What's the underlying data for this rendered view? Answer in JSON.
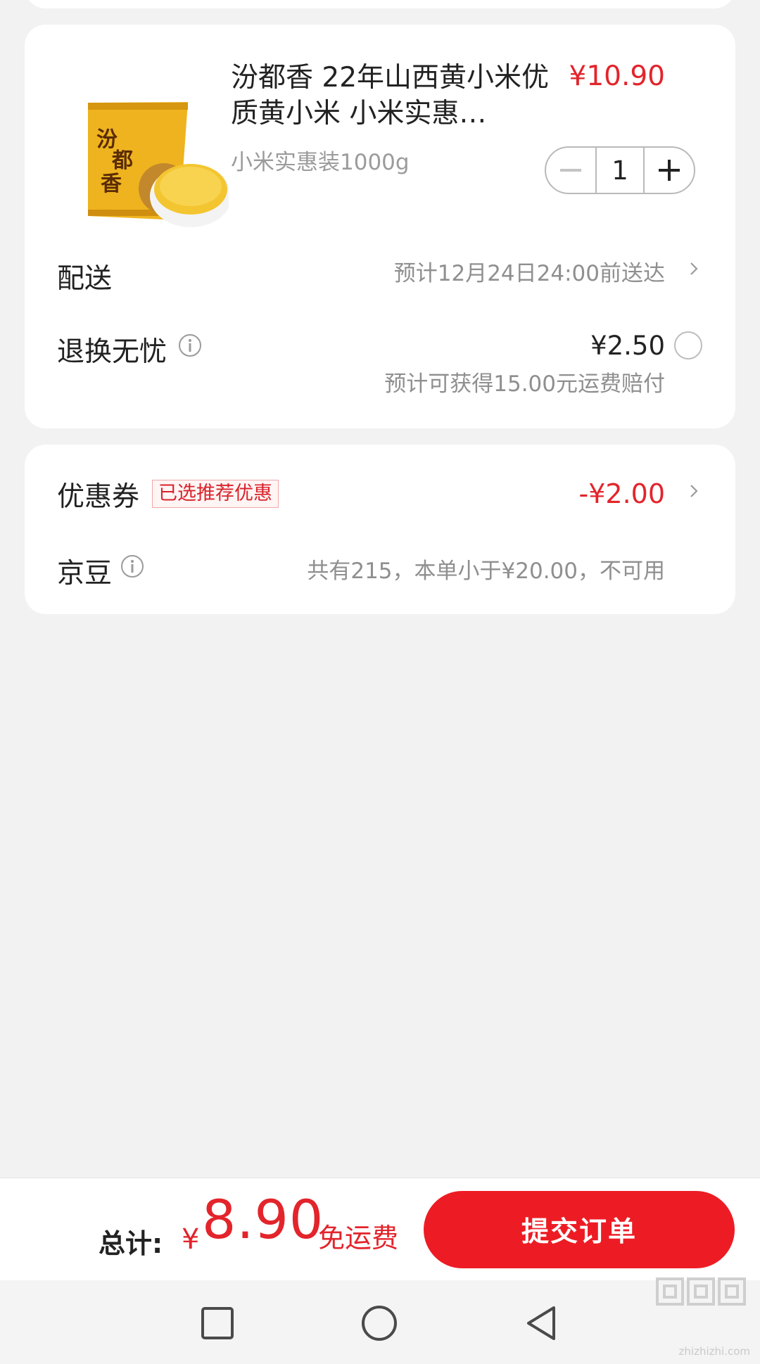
{
  "product": {
    "title": "汾都香 22年山西黄小米优质黄小米 小米实惠…",
    "price": "¥10.90",
    "spec": "小米实惠装1000g",
    "quantity": "1",
    "image_text": "汾都香"
  },
  "delivery": {
    "label": "配送",
    "value": "预计12月24日24:00前送达"
  },
  "return_insurance": {
    "label": "退换无忧",
    "price": "¥2.50",
    "note": "预计可获得15.00元运费赔付"
  },
  "coupon": {
    "label": "优惠券",
    "badge": "已选推荐优惠",
    "value": "-¥2.00"
  },
  "jingdou": {
    "label": "京豆",
    "note": "共有215，本单小于¥20.00，不可用"
  },
  "footer": {
    "total_label": "总计:",
    "currency": "¥",
    "total_amount": "8.90",
    "free_shipping": "免运费",
    "submit_label": "提交订单"
  },
  "watermark": {
    "domain": "zhizhizhi.com"
  },
  "colors": {
    "accent": "#e3242b",
    "button": "#ed1c24",
    "page_bg": "#f2f2f2"
  },
  "icons": [
    "minus-icon",
    "plus-icon",
    "chevron-right-icon",
    "info-icon",
    "radio-icon",
    "nav-square-icon",
    "nav-circle-icon",
    "nav-back-icon"
  ]
}
